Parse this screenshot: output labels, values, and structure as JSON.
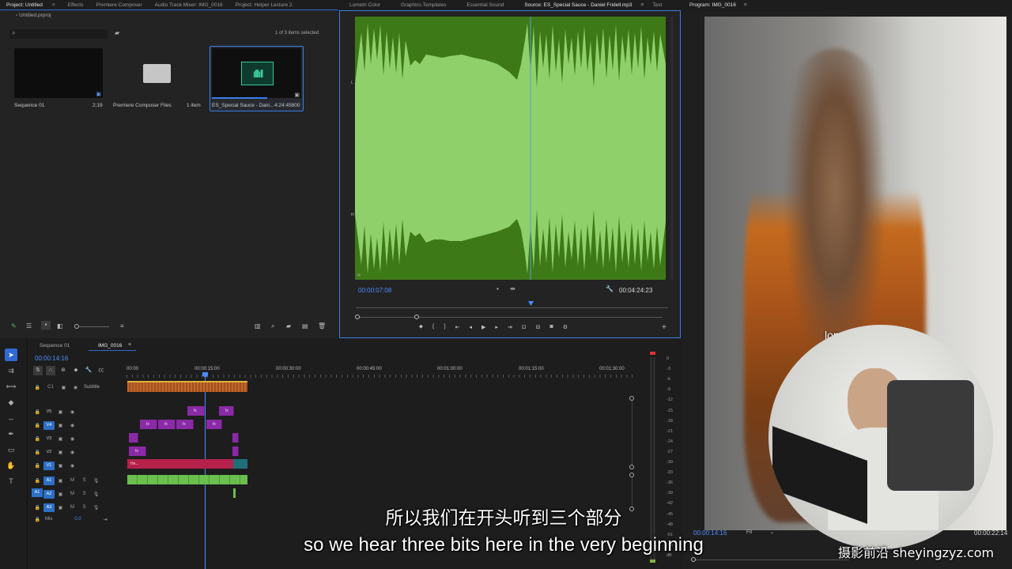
{
  "project_panel": {
    "tabs": [
      "Project: Untitled",
      "Effects",
      "Premiere Composer",
      "Audio Track Mixer: IMG_0016",
      "Project: Helper Lecture 2.",
      "Lumetri Color",
      "Graphics Templates",
      "Essential Sound",
      "Source: ES_Special Sauce - Daniel Fridell.mp3",
      "Text"
    ],
    "file_name": "Untitled.prproj",
    "selection_count": "1 of 3 items selected",
    "items": [
      {
        "name": "Sequence 01",
        "meta": "2;19"
      },
      {
        "name": "Premiere Composer Files",
        "meta": "1 item"
      },
      {
        "name": "ES_Special Sauce - Dani...",
        "meta": "4:24:45800"
      }
    ]
  },
  "source_monitor": {
    "channel_labels": [
      "L",
      "L",
      "R",
      "R"
    ],
    "timecode_in": "00:00:07:08",
    "duration": "00:04:24:23"
  },
  "program_monitor": {
    "title": "Program: IMG_0016",
    "timecode": "00:00:14:16",
    "fit": "Fit",
    "duration": "00:00:22:14",
    "overlay_text": "longer"
  },
  "timeline": {
    "tabs": [
      "Sequence 01",
      "IMG_0016"
    ],
    "playhead": "00:00:14:16",
    "ruler": [
      "00:00",
      "00:00:15:00",
      "00:00:30:00",
      "00:00:45:00",
      "00:01:00:00",
      "00:01:15:00",
      "00:01:30:00"
    ],
    "subtitle_track": {
      "label": "C1",
      "name": "Subtitle"
    },
    "video_tracks": [
      "V5",
      "V4",
      "V3",
      "V2",
      "V1"
    ],
    "audio_tracks": [
      "A1",
      "A2",
      "A3"
    ],
    "source_patch": "A1",
    "mix_label": "Mix",
    "mix_value": "0.0",
    "clip_fx": "fx",
    "clip_v1_name": "He..."
  },
  "audio_meter": {
    "scale": [
      "0",
      "-3",
      "-6",
      "-9",
      "-12",
      "-15",
      "-18",
      "-21",
      "-24",
      "-27",
      "-30",
      "-33",
      "-36",
      "-39",
      "-42",
      "-45",
      "-48",
      "-51",
      "-54",
      "dB"
    ]
  },
  "subtitles": {
    "chinese": "所以我们在开头听到三个部分",
    "english": "so we hear three bits here in the very beginning"
  },
  "watermark": "摄影前沿 sheyingzyz.com",
  "colors": {
    "waveform_bg": "#3d7a17",
    "waveform_fg": "#8fd06b",
    "accent_blue": "#4b8cff",
    "video_clip": "#8a2aa6",
    "audio_clip": "#6bbf4e"
  }
}
